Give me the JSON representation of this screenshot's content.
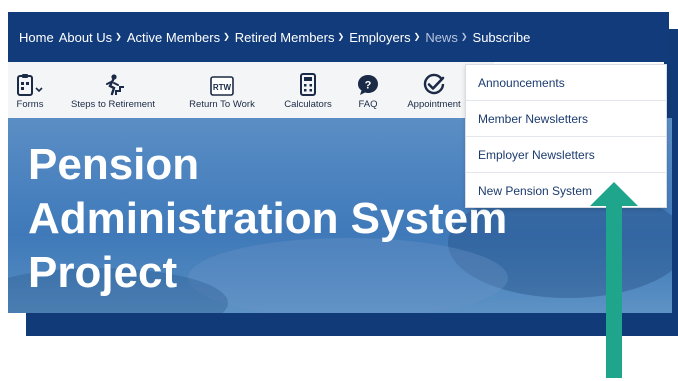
{
  "nav": {
    "items": [
      {
        "label": "Home",
        "chevron": false,
        "state": "normal"
      },
      {
        "label": "About Us",
        "chevron": true,
        "state": "normal"
      },
      {
        "label": "Active Members",
        "chevron": true,
        "state": "normal"
      },
      {
        "label": "Retired Members",
        "chevron": true,
        "state": "normal"
      },
      {
        "label": "Employers",
        "chevron": true,
        "state": "normal"
      },
      {
        "label": "News",
        "chevron": true,
        "state": "active"
      },
      {
        "label": "Subscribe",
        "chevron": false,
        "state": "normal"
      }
    ]
  },
  "toolbar": {
    "forms_label": "Forms",
    "steps_label": "Steps to Retirement",
    "rtw_label": "Return To Work",
    "rtw_icon_text": "RTW",
    "calculators_label": "Calculators",
    "faq_label": "FAQ",
    "appointment_label": "Appointment"
  },
  "hero": {
    "title": "Pension\nAdministration System\nProject"
  },
  "news_menu": {
    "items": [
      "Announcements",
      "Member Newsletters",
      "Employer Newsletters",
      "New Pension System"
    ]
  },
  "colors": {
    "nav_bg": "#123b7c",
    "accent_arrow": "#1ea58c",
    "menu_text": "#1c3b6e"
  }
}
